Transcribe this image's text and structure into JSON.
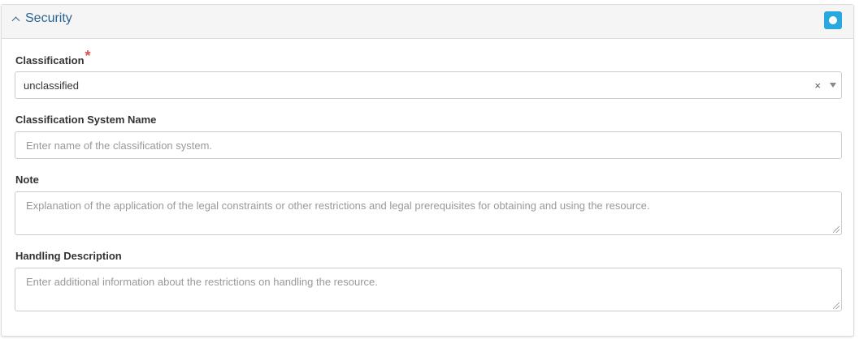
{
  "panel": {
    "title": "Security",
    "status_icon": "circle-icon",
    "accent_color": "#29a7df"
  },
  "fields": {
    "classification": {
      "label": "Classification",
      "required_mark": "*",
      "value": "unclassified",
      "clear_glyph": "×"
    },
    "classification_system_name": {
      "label": "Classification System Name",
      "placeholder": "Enter name of the classification system."
    },
    "note": {
      "label": "Note",
      "placeholder": "Explanation of the application of the legal constraints or other restrictions and legal prerequisites for obtaining and using the resource."
    },
    "handling_description": {
      "label": "Handling Description",
      "placeholder": "Enter additional information about the restrictions on handling the resource."
    }
  }
}
